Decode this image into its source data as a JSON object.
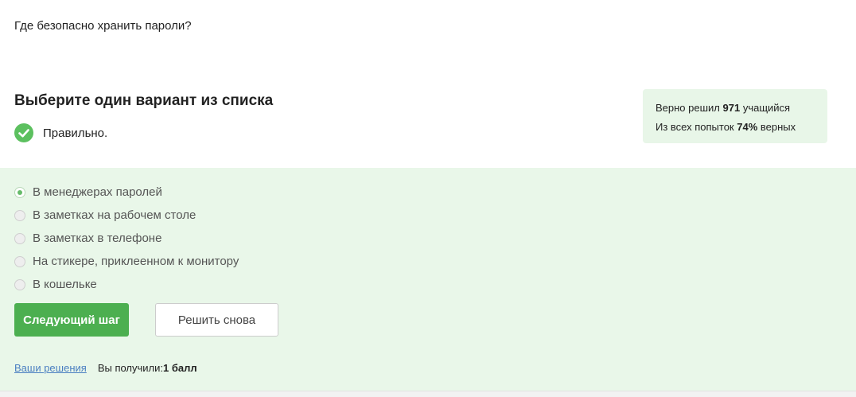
{
  "question": "Где безопасно хранить пароли?",
  "heading": "Выберите один вариант из списка",
  "result": {
    "text": "Правильно.",
    "icon": "check-circle-icon",
    "icon_color": "#5cc05f"
  },
  "stats": {
    "line1_prefix": "Верно решил ",
    "line1_value": "971",
    "line1_suffix": " учащийся",
    "line2_prefix": "Из всех попыток ",
    "line2_value": "74%",
    "line2_suffix": " верных"
  },
  "options": [
    {
      "label": "В менеджерах паролей",
      "checked": true
    },
    {
      "label": "В заметках на рабочем столе",
      "checked": false
    },
    {
      "label": "В заметках в телефоне",
      "checked": false
    },
    {
      "label": "На стикере, приклеенном к монитору",
      "checked": false
    },
    {
      "label": "В кошельке",
      "checked": false
    }
  ],
  "buttons": {
    "next": "Следующий шаг",
    "retry": "Решить снова"
  },
  "footer": {
    "link": "Ваши решения",
    "score_prefix": "Вы получили: ",
    "score_value": "1 балл"
  },
  "colors": {
    "accent": "#4caf50",
    "answer_bg": "#e9f7e9",
    "stats_bg": "#e8f6e8",
    "link": "#4a7fc1"
  }
}
